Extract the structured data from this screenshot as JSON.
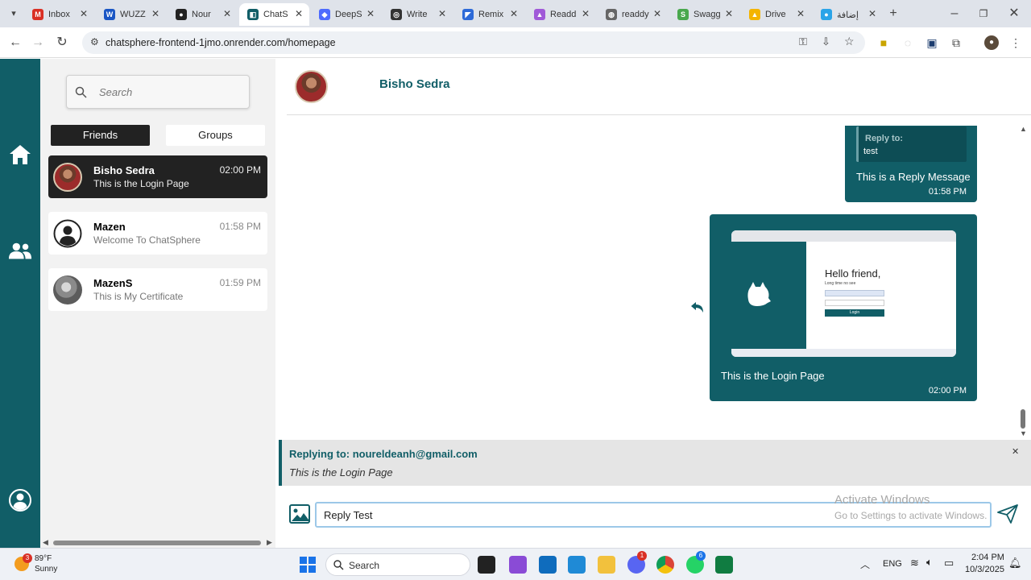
{
  "browser": {
    "tabs": [
      {
        "label": "Inbox",
        "color": "#d93025",
        "glyph": "M"
      },
      {
        "label": "WUZZ",
        "color": "#1a56c4",
        "glyph": "W"
      },
      {
        "label": "Nour",
        "color": "#222222",
        "glyph": "●"
      },
      {
        "label": "ChatS",
        "color": "#115e67",
        "glyph": "◧"
      },
      {
        "label": "DeepS",
        "color": "#4d6bfe",
        "glyph": "◆"
      },
      {
        "label": "Write",
        "color": "#333333",
        "glyph": "◎"
      },
      {
        "label": "Remix",
        "color": "#2d6ad8",
        "glyph": "◤"
      },
      {
        "label": "Readd",
        "color": "#a05ad8",
        "glyph": "▲"
      },
      {
        "label": "readdy",
        "color": "#666666",
        "glyph": "◍"
      },
      {
        "label": "Swagg",
        "color": "#49a84d",
        "glyph": "S"
      },
      {
        "label": "Drive",
        "color": "#f4b400",
        "glyph": "▲"
      },
      {
        "label": "إضافة",
        "color": "#2aa4e8",
        "glyph": "●"
      }
    ],
    "url": "chatsphere-frontend-1jmo.onrender.com/homepage"
  },
  "sidebar": {
    "search_placeholder": "Search",
    "tabs": {
      "friends": "Friends",
      "groups": "Groups"
    },
    "friends": [
      {
        "name": "Bisho Sedra",
        "message": "This is the Login Page",
        "time": "02:00 PM"
      },
      {
        "name": "Mazen",
        "message": "Welcome To ChatSphere",
        "time": "01:58 PM"
      },
      {
        "name": "MazenS",
        "message": "This is My Certificate",
        "time": "01:59 PM"
      }
    ]
  },
  "chat": {
    "header_name": "Bisho Sedra",
    "reply_message": {
      "quote_label": "Reply to:",
      "quote_text": "test",
      "text": "This is a Reply Message",
      "time": "01:58 PM"
    },
    "image_message": {
      "text": "This is the Login Page",
      "time": "02:00 PM",
      "preview_heading": "Hello friend,",
      "preview_sub": "Long time no see",
      "preview_button": "Login"
    }
  },
  "replybar": {
    "title": "Replying to: noureldeanh@gmail.com",
    "quote": "This is the Login Page"
  },
  "composer": {
    "value": "Reply Test"
  },
  "watermark": {
    "line1": "Activate Windows",
    "line2": "Go to Settings to activate Windows."
  },
  "taskbar": {
    "weather_temp": "89°F",
    "weather_desc": "Sunny",
    "weather_badge": "3",
    "search_label": "Search",
    "lang": "ENG",
    "time": "2:04 PM",
    "date": "10/3/2025",
    "discord_badge": "1",
    "whatsapp_badge": "6"
  },
  "colors": {
    "accent": "#115e67",
    "dark": "#222222"
  }
}
